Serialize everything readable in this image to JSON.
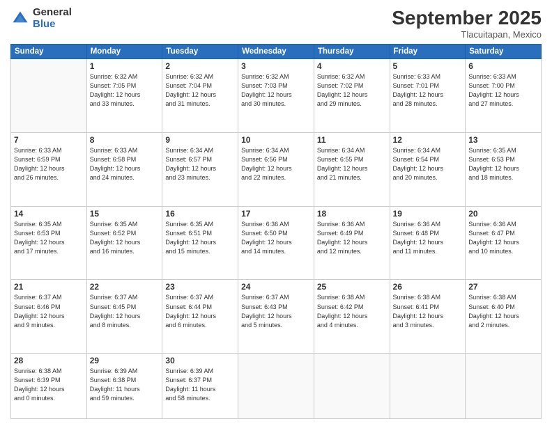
{
  "logo": {
    "general": "General",
    "blue": "Blue"
  },
  "header": {
    "month": "September 2025",
    "location": "Tlacuitapan, Mexico"
  },
  "days_of_week": [
    "Sunday",
    "Monday",
    "Tuesday",
    "Wednesday",
    "Thursday",
    "Friday",
    "Saturday"
  ],
  "weeks": [
    [
      {
        "day": "",
        "info": ""
      },
      {
        "day": "1",
        "info": "Sunrise: 6:32 AM\nSunset: 7:05 PM\nDaylight: 12 hours\nand 33 minutes."
      },
      {
        "day": "2",
        "info": "Sunrise: 6:32 AM\nSunset: 7:04 PM\nDaylight: 12 hours\nand 31 minutes."
      },
      {
        "day": "3",
        "info": "Sunrise: 6:32 AM\nSunset: 7:03 PM\nDaylight: 12 hours\nand 30 minutes."
      },
      {
        "day": "4",
        "info": "Sunrise: 6:32 AM\nSunset: 7:02 PM\nDaylight: 12 hours\nand 29 minutes."
      },
      {
        "day": "5",
        "info": "Sunrise: 6:33 AM\nSunset: 7:01 PM\nDaylight: 12 hours\nand 28 minutes."
      },
      {
        "day": "6",
        "info": "Sunrise: 6:33 AM\nSunset: 7:00 PM\nDaylight: 12 hours\nand 27 minutes."
      }
    ],
    [
      {
        "day": "7",
        "info": "Sunrise: 6:33 AM\nSunset: 6:59 PM\nDaylight: 12 hours\nand 26 minutes."
      },
      {
        "day": "8",
        "info": "Sunrise: 6:33 AM\nSunset: 6:58 PM\nDaylight: 12 hours\nand 24 minutes."
      },
      {
        "day": "9",
        "info": "Sunrise: 6:34 AM\nSunset: 6:57 PM\nDaylight: 12 hours\nand 23 minutes."
      },
      {
        "day": "10",
        "info": "Sunrise: 6:34 AM\nSunset: 6:56 PM\nDaylight: 12 hours\nand 22 minutes."
      },
      {
        "day": "11",
        "info": "Sunrise: 6:34 AM\nSunset: 6:55 PM\nDaylight: 12 hours\nand 21 minutes."
      },
      {
        "day": "12",
        "info": "Sunrise: 6:34 AM\nSunset: 6:54 PM\nDaylight: 12 hours\nand 20 minutes."
      },
      {
        "day": "13",
        "info": "Sunrise: 6:35 AM\nSunset: 6:53 PM\nDaylight: 12 hours\nand 18 minutes."
      }
    ],
    [
      {
        "day": "14",
        "info": "Sunrise: 6:35 AM\nSunset: 6:53 PM\nDaylight: 12 hours\nand 17 minutes."
      },
      {
        "day": "15",
        "info": "Sunrise: 6:35 AM\nSunset: 6:52 PM\nDaylight: 12 hours\nand 16 minutes."
      },
      {
        "day": "16",
        "info": "Sunrise: 6:35 AM\nSunset: 6:51 PM\nDaylight: 12 hours\nand 15 minutes."
      },
      {
        "day": "17",
        "info": "Sunrise: 6:36 AM\nSunset: 6:50 PM\nDaylight: 12 hours\nand 14 minutes."
      },
      {
        "day": "18",
        "info": "Sunrise: 6:36 AM\nSunset: 6:49 PM\nDaylight: 12 hours\nand 12 minutes."
      },
      {
        "day": "19",
        "info": "Sunrise: 6:36 AM\nSunset: 6:48 PM\nDaylight: 12 hours\nand 11 minutes."
      },
      {
        "day": "20",
        "info": "Sunrise: 6:36 AM\nSunset: 6:47 PM\nDaylight: 12 hours\nand 10 minutes."
      }
    ],
    [
      {
        "day": "21",
        "info": "Sunrise: 6:37 AM\nSunset: 6:46 PM\nDaylight: 12 hours\nand 9 minutes."
      },
      {
        "day": "22",
        "info": "Sunrise: 6:37 AM\nSunset: 6:45 PM\nDaylight: 12 hours\nand 8 minutes."
      },
      {
        "day": "23",
        "info": "Sunrise: 6:37 AM\nSunset: 6:44 PM\nDaylight: 12 hours\nand 6 minutes."
      },
      {
        "day": "24",
        "info": "Sunrise: 6:37 AM\nSunset: 6:43 PM\nDaylight: 12 hours\nand 5 minutes."
      },
      {
        "day": "25",
        "info": "Sunrise: 6:38 AM\nSunset: 6:42 PM\nDaylight: 12 hours\nand 4 minutes."
      },
      {
        "day": "26",
        "info": "Sunrise: 6:38 AM\nSunset: 6:41 PM\nDaylight: 12 hours\nand 3 minutes."
      },
      {
        "day": "27",
        "info": "Sunrise: 6:38 AM\nSunset: 6:40 PM\nDaylight: 12 hours\nand 2 minutes."
      }
    ],
    [
      {
        "day": "28",
        "info": "Sunrise: 6:38 AM\nSunset: 6:39 PM\nDaylight: 12 hours\nand 0 minutes."
      },
      {
        "day": "29",
        "info": "Sunrise: 6:39 AM\nSunset: 6:38 PM\nDaylight: 11 hours\nand 59 minutes."
      },
      {
        "day": "30",
        "info": "Sunrise: 6:39 AM\nSunset: 6:37 PM\nDaylight: 11 hours\nand 58 minutes."
      },
      {
        "day": "",
        "info": ""
      },
      {
        "day": "",
        "info": ""
      },
      {
        "day": "",
        "info": ""
      },
      {
        "day": "",
        "info": ""
      }
    ]
  ]
}
